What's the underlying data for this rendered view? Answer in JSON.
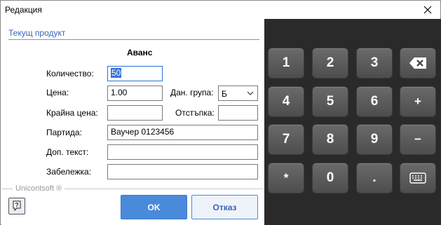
{
  "window": {
    "title": "Редакция"
  },
  "header": {
    "product_link": "Текущ продукт",
    "heading": "Аванс"
  },
  "form": {
    "quantity_label": "Количество:",
    "quantity_value": "50",
    "price_label": "Цена:",
    "price_value": "1.00",
    "tax_group_label": "Дан. група:",
    "tax_group_value": "Б",
    "final_price_label": "Крайна цена:",
    "final_price_value": "",
    "discount_label": "Отстъпка:",
    "discount_value": "",
    "batch_label": "Партида:",
    "batch_value": "Ваучер 0123456",
    "extra_text_label": "Доп. текст:",
    "extra_text_value": "",
    "note_label": "Забележка:",
    "note_value": ""
  },
  "footer": {
    "brand": "Unicontsoft ®",
    "ok_label": "OK",
    "cancel_label": "Отказ"
  },
  "keypad": {
    "keys": [
      "1",
      "2",
      "3",
      "4",
      "5",
      "6",
      "7",
      "8",
      "9",
      "*",
      "0",
      ".",
      "+",
      "−"
    ]
  },
  "colors": {
    "accent": "#4a8adb",
    "link": "#3a63b4",
    "keypad_bg": "#2a2a2a"
  },
  "icons": [
    "close-icon",
    "chevron-down-icon",
    "help-icon",
    "backspace-icon",
    "keyboard-icon"
  ]
}
